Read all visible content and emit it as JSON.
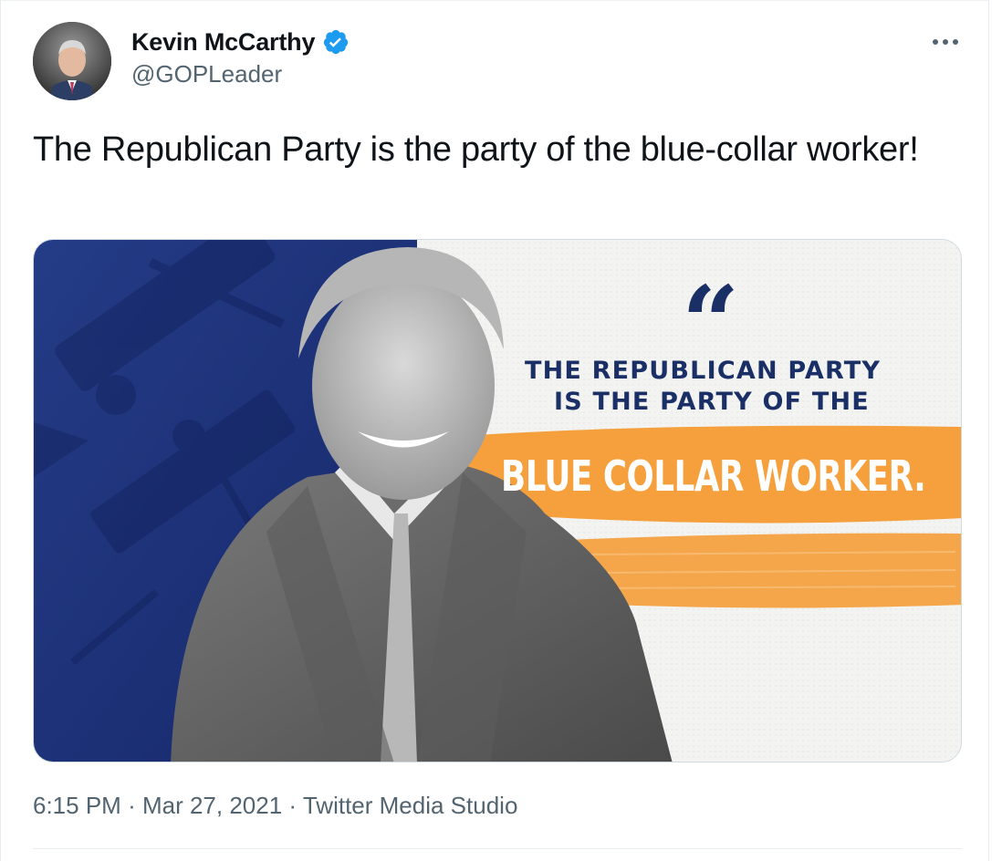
{
  "author": {
    "name": "Kevin McCarthy",
    "handle": "@GOPLeader",
    "verified": true,
    "verified_color": "#1d9bf0"
  },
  "tweet": {
    "text": "The Republican Party is the party of the blue-collar worker!"
  },
  "media": {
    "quote_mark": "“",
    "line1": "THE REPUBLICAN PARTY",
    "line2": "IS THE PARTY OF THE",
    "highlight": "BLUE COLLAR WORKER.",
    "colors": {
      "navy": "#1a2f66",
      "orange": "#f5a03c"
    }
  },
  "meta": {
    "time": "6:15 PM",
    "date": "Mar 27, 2021",
    "source": "Twitter Media Studio",
    "separator": "·"
  },
  "icons": [
    "verified-badge-icon",
    "more-options-icon"
  ]
}
